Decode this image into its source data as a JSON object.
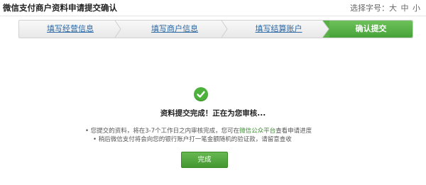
{
  "header": {
    "title": "微信支付商户资料申请提交确认",
    "font_size_label": "选择字号：",
    "font_sizes": [
      "大",
      "中",
      "小"
    ]
  },
  "steps": [
    {
      "label": "填写经营信息",
      "state": "done"
    },
    {
      "label": "填写商户信息",
      "state": "done"
    },
    {
      "label": "填写结算账户",
      "state": "done"
    },
    {
      "label": "确认提交",
      "state": "active"
    }
  ],
  "colors": {
    "accent_green": "#4db23b",
    "link_blue": "#2b68a3"
  },
  "result": {
    "icon": "check-circle-icon",
    "message": "资料提交完成！正在为您审核..."
  },
  "notes": {
    "line1_prefix": "• 您提交的资料，将在3-7个工作日之内审核完成，您可在",
    "line1_link": "微信公众平台",
    "line1_suffix": "查看申请进度",
    "line2": "• 稍后微信支付将会向您的银行账户打一笔金额随机的验证款，请留意查收"
  },
  "finish_button": "完成"
}
